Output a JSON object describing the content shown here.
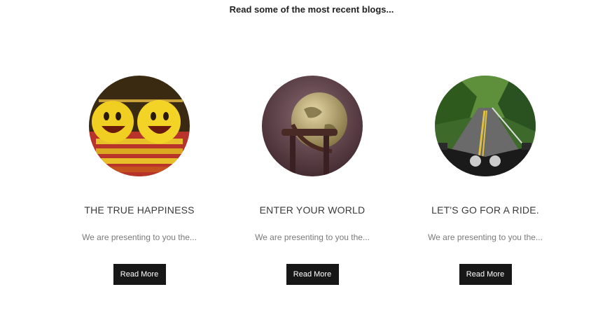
{
  "intro_text": "Read some of the most recent blogs...",
  "posts": [
    {
      "title": "THE TRUE HAPPINESS",
      "excerpt": "We are presenting to you the...",
      "button_label": "Read More",
      "image": "smiley-faces-photo"
    },
    {
      "title": "ENTER YOUR WORLD",
      "excerpt": "We are presenting to you the...",
      "button_label": "Read More",
      "image": "antique-globe-photo"
    },
    {
      "title": "LET'S GO FOR A RIDE.",
      "excerpt": "We are presenting to you the...",
      "button_label": "Read More",
      "image": "motorcycle-road-photo"
    }
  ],
  "colors": {
    "button_bg": "#171717",
    "button_text": "#ffffff",
    "title_text": "#3a3a3a",
    "excerpt_text": "#7a7a7a"
  }
}
